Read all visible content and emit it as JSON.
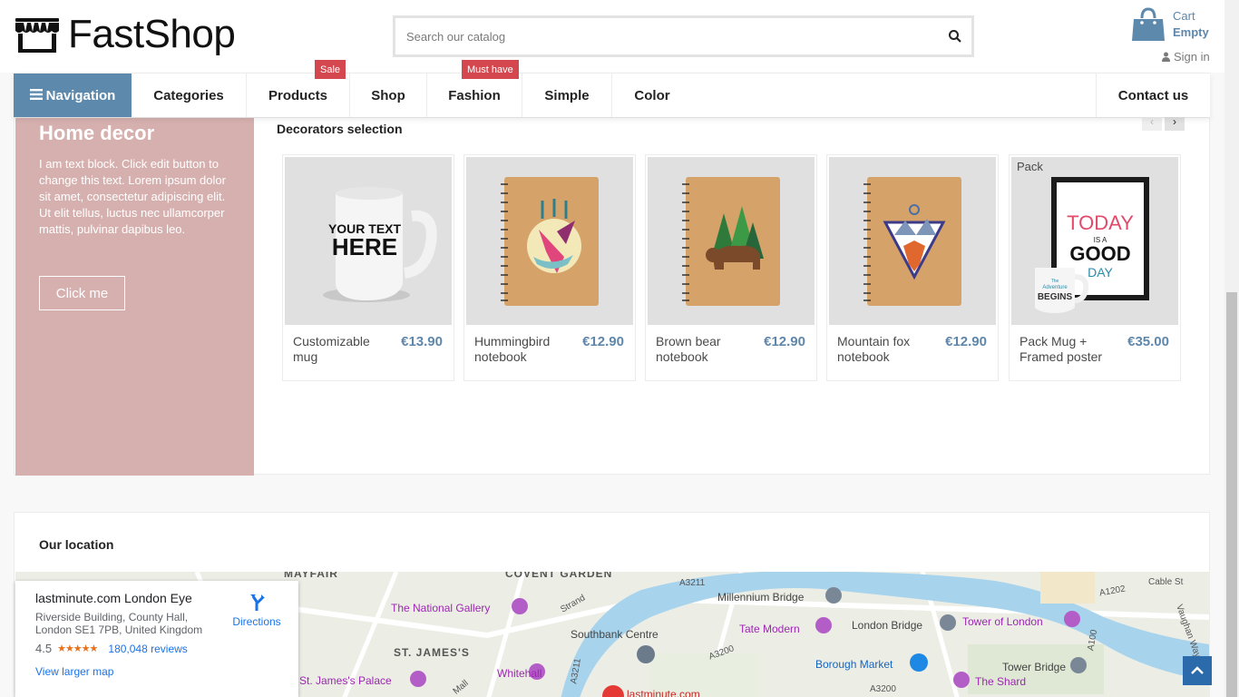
{
  "header": {
    "logo_text": "FastShop",
    "search_placeholder": "Search our catalog",
    "cart_label": "Cart",
    "cart_value": "Empty",
    "signin_label": "Sign in"
  },
  "nav": {
    "items": [
      {
        "label": "Navigation"
      },
      {
        "label": "Categories"
      },
      {
        "label": "Products",
        "badge": "Sale"
      },
      {
        "label": "Shop"
      },
      {
        "label": "Fashion",
        "badge": "Must have"
      },
      {
        "label": "Simple"
      },
      {
        "label": "Color"
      },
      {
        "label": "Contact us"
      }
    ]
  },
  "decor": {
    "title": "Home decor",
    "text": "I am text block. Click edit button to change this text. Lorem ipsum dolor sit amet, consectetur adipiscing elit. Ut elit tellus, luctus nec ullamcorper mattis, pulvinar dapibus leo.",
    "button": "Click me"
  },
  "selection": {
    "title": "Decorators selection",
    "prev_icon": "chevron-left-icon",
    "next_icon": "chevron-right-icon",
    "products": [
      {
        "name": "Customizable mug",
        "price": "€13.90"
      },
      {
        "name": "Hummingbird notebook",
        "price": "€12.90"
      },
      {
        "name": "Brown bear notebook",
        "price": "€12.90"
      },
      {
        "name": "Mountain fox notebook",
        "price": "€12.90"
      },
      {
        "name": "Pack Mug + Framed poster",
        "price": "€35.00",
        "flag": "Pack"
      }
    ],
    "mug_print": [
      "YOUR TEXT",
      "HERE"
    ],
    "poster_print": [
      "TODAY",
      "IS A",
      "GOOD",
      "DAY"
    ],
    "poster_mug_print": [
      "The",
      "Adventure",
      "BEGINS"
    ]
  },
  "location": {
    "title": "Our location",
    "place_name": "lastminute.com London Eye",
    "address": "Riverside Building, County Hall, London SE1 7PB, United Kingdom",
    "rating": "4.5",
    "stars": "★★★★★",
    "reviews": "180,048 reviews",
    "larger_map": "View larger map",
    "directions": "Directions",
    "map_labels": [
      "MAYFAIR",
      "COVENT GARDEN",
      "A3211",
      "Millennium Bridge",
      "A1202",
      "Cable St",
      "The National Gallery",
      "Strand",
      "Tate Modern",
      "London Bridge",
      "Tower of London",
      "Southbank Centre",
      "ST. JAMES'S",
      "A3200",
      "A100",
      "Vaughan Way",
      "St. James's Palace",
      "Whitehall",
      "Borough Market",
      "Tower Bridge",
      "The Shard",
      "lastminute.com",
      "Mall",
      "A3211",
      "A3200"
    ]
  },
  "colors": {
    "accent": "#5d89ad",
    "badge": "#d5474e",
    "decor_panel": "#d6b0ae",
    "price": "#5f87ab"
  }
}
